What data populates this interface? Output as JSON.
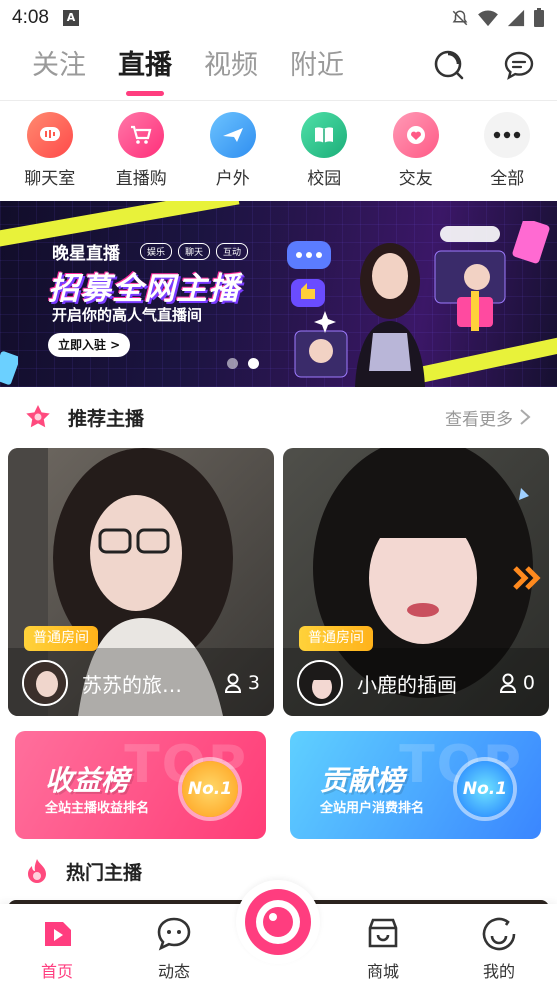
{
  "status_bar": {
    "time": "4:08",
    "a_badge": "A"
  },
  "top_tabs": [
    {
      "label": "关注",
      "active": false
    },
    {
      "label": "直播",
      "active": true
    },
    {
      "label": "视频",
      "active": false
    },
    {
      "label": "附近",
      "active": false
    }
  ],
  "categories": [
    {
      "label": "聊天室",
      "icon": "chat-wave-icon",
      "color": "#ff5a4e"
    },
    {
      "label": "直播购",
      "icon": "cart-icon",
      "color": "#ff3d8a"
    },
    {
      "label": "户外",
      "icon": "airplane-icon",
      "color": "#3aa0f5"
    },
    {
      "label": "校园",
      "icon": "book-icon",
      "color": "#27c28f"
    },
    {
      "label": "交友",
      "icon": "heart-icon",
      "color": "#ff6f95"
    },
    {
      "label": "全部",
      "icon": "more-dots-icon",
      "color": "#f4f4f4"
    }
  ],
  "banner": {
    "brand": "晚星直播",
    "tags": [
      "娱乐",
      "聊天",
      "互动"
    ],
    "title": "招募全网主播",
    "subtitle": "开启你的高人气直播间",
    "button": "立即入驻 >",
    "slides": 2,
    "active_slide": 1
  },
  "recommended": {
    "title": "推荐主播",
    "more": "查看更多",
    "cards": [
      {
        "badge": "普通房间",
        "name": "苏苏的旅行日记",
        "count": "3"
      },
      {
        "badge": "普通房间",
        "name": "小鹿的插画",
        "count": "0"
      }
    ]
  },
  "ranks": [
    {
      "title": "收益榜",
      "subtitle": "全站主播收益排名",
      "medal": "No.1",
      "ghost": "TOP",
      "color_from": "#ff5b8f",
      "color_to": "#ff3d77"
    },
    {
      "title": "贡献榜",
      "subtitle": "全站用户消费排名",
      "medal": "No.1",
      "ghost": "TOP",
      "color_from": "#52c3ff",
      "color_to": "#3a8bff"
    }
  ],
  "hot": {
    "title": "热门主播"
  },
  "bottom_nav": [
    {
      "label": "首页",
      "icon": "home-play-icon",
      "active": true
    },
    {
      "label": "动态",
      "icon": "chat-bubble-icon",
      "active": false
    },
    {
      "label": "商城",
      "icon": "shop-icon",
      "active": false
    },
    {
      "label": "我的",
      "icon": "smile-icon",
      "active": false
    }
  ],
  "colors": {
    "accent": "#ff3d7f",
    "badge_yellow": "#ffc02a"
  }
}
